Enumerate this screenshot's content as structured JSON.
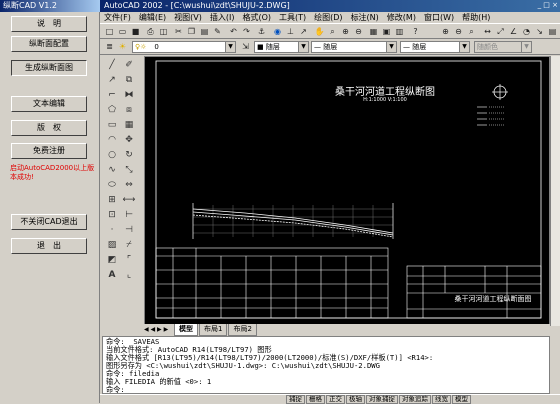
{
  "left_app": {
    "title": "纵断CAD V1.2",
    "buttons": [
      "说　明",
      "纵断面配置",
      "生成纵断面图",
      "文本编辑",
      "版　权",
      "免费注册",
      "不关闭CAD退出",
      "退　出"
    ],
    "note": "启动AutoCAD2000以上版本成功!"
  },
  "cad": {
    "title": "AutoCAD 2002 - [C:\\wushui\\zdt\\SHUJU-2.DWG]",
    "menu": [
      "文件(F)",
      "编辑(E)",
      "视图(V)",
      "插入(I)",
      "格式(O)",
      "工具(T)",
      "绘图(D)",
      "标注(N)",
      "修改(M)",
      "窗口(W)",
      "帮助(H)"
    ],
    "layer_value": "0",
    "color_value": "随层",
    "linetype_value": "随层",
    "lineweight_value": "随层",
    "plotstyle_value": "随颜色",
    "drawing_title": "桑干河河道工程纵断图",
    "drawing_subtitle": "H:1:1000   V:1:100",
    "tb_title": "桑干河河道工程纵断面图",
    "tabs": [
      "模型",
      "布局1",
      "布局2"
    ],
    "command_lines": [
      "命令: _SAVEAS",
      "当前文件格式: AutoCAD R14(LT98/LT97) 图形",
      "输入文件格式 [R13(LT95)/R14(LT98/LT97)/2000(LT2000)/标准(S)/DXF/样板(T)] <R14>:",
      "图形另存为 <C:\\wushui\\zdt\\SHUJU-1.dwg>: C:\\wushui\\zdt\\SHUJU-2.DWG",
      "命令: filedia",
      "输入 FILEDIA 的新值 <0>: 1",
      "命令:"
    ],
    "status": [
      "捕捉",
      "栅格",
      "正交",
      "极轴",
      "对象捕捉",
      "对象追踪",
      "线宽",
      "模型"
    ]
  },
  "colors": {
    "titlebar": "#0a246a",
    "canvas": "#000000",
    "note": "#e00000"
  }
}
